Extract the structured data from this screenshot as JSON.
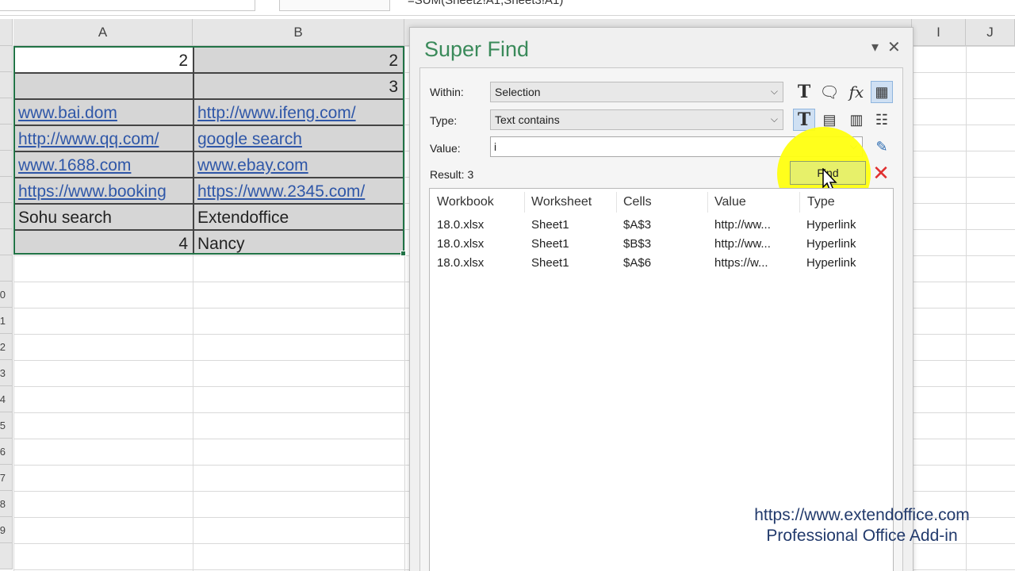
{
  "formula_bar": {
    "formula": "=SUM(Sheet2!A1,Sheet3!A1)"
  },
  "columns": {
    "a": "A",
    "b": "B",
    "i": "I",
    "j": "J"
  },
  "row_labels": [
    "0",
    "1",
    "2",
    "3",
    "4",
    "5",
    "6",
    "7",
    "8",
    "9"
  ],
  "cells": {
    "r1": {
      "a": "2",
      "b": "2"
    },
    "r2": {
      "a": "",
      "b": "3"
    },
    "r3": {
      "a": "www.bai.dom",
      "b": "http://www.ifeng.com/"
    },
    "r4": {
      "a": "http://www.qq.com/",
      "b": "google search"
    },
    "r5": {
      "a": "www.1688.com",
      "b": "www.ebay.com"
    },
    "r6": {
      "a": "https://www.booking",
      "b": "https://www.2345.com/"
    },
    "r7": {
      "a": "Sohu search",
      "b": "Extendoffice"
    },
    "r8": {
      "a": "4",
      "b": "Nancy"
    }
  },
  "dialog": {
    "title": "Super Find",
    "within_label": "Within:",
    "within_value": "Selection",
    "type_label": "Type:",
    "type_value": "Text contains",
    "value_label": "Value:",
    "value_value": "i",
    "result": "Result: 3",
    "find_label": "Find",
    "list_headers": [
      "Workbook",
      "Worksheet",
      "Cells",
      "Value",
      "Type"
    ],
    "rows": [
      [
        "18.0.xlsx",
        "Sheet1",
        "$A$3",
        "http://ww...",
        "Hyperlink"
      ],
      [
        "18.0.xlsx",
        "Sheet1",
        "$B$3",
        "http://ww...",
        "Hyperlink"
      ],
      [
        "18.0.xlsx",
        "Sheet1",
        "$A$6",
        "https://w...",
        "Hyperlink"
      ]
    ]
  },
  "watermark": {
    "url": "https://www.extendoffice.com",
    "tagline": "Professional Office Add-in"
  },
  "colors": {
    "accent_green": "#217346",
    "title_green": "#3a8a5a",
    "link_blue": "#2f57a8",
    "highlight": "#ffff10",
    "footer_blue": "#223a6c"
  }
}
